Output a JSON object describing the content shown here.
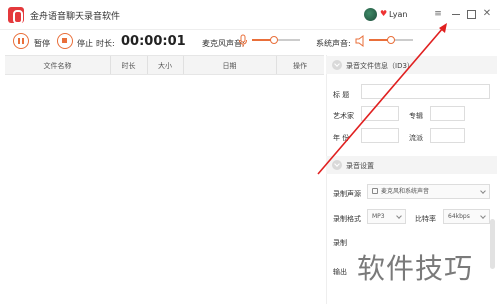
{
  "window": {
    "title": "金舟语音聊天录音软件",
    "user_name": "Lyan",
    "menu_glyph": "≡",
    "close_glyph": "✕"
  },
  "toolbar": {
    "pause_label": "暂停",
    "stop_label": "停止",
    "duration_label": "时长:",
    "timer": "00:00:01",
    "mic_label": "麦克风声音:",
    "system_label": "系统声音:",
    "mic_level": 0.45,
    "system_level": 0.5
  },
  "table": {
    "columns": [
      "文件名称",
      "时长",
      "大小",
      "日期",
      "操作"
    ]
  },
  "file_info": {
    "title": "录音文件信息（ID3）",
    "title_label": "标  题",
    "artist_label": "艺术家",
    "album_label": "专辑",
    "year_label": "年  份",
    "genre_label": "流派"
  },
  "settings": {
    "title": "录音设置",
    "source_label": "录制声源",
    "source_value": "麦克风和系统声音",
    "format_label": "录制格式",
    "format_value": "MP3",
    "bitrate_label": "比特率",
    "bitrate_value": "64kbps",
    "record_label": "录制",
    "output_label": "输出"
  },
  "watermark": "软件技巧",
  "colors": {
    "accent": "#e96f3a",
    "logo": "#e4393c",
    "arrow": "#e02020"
  }
}
